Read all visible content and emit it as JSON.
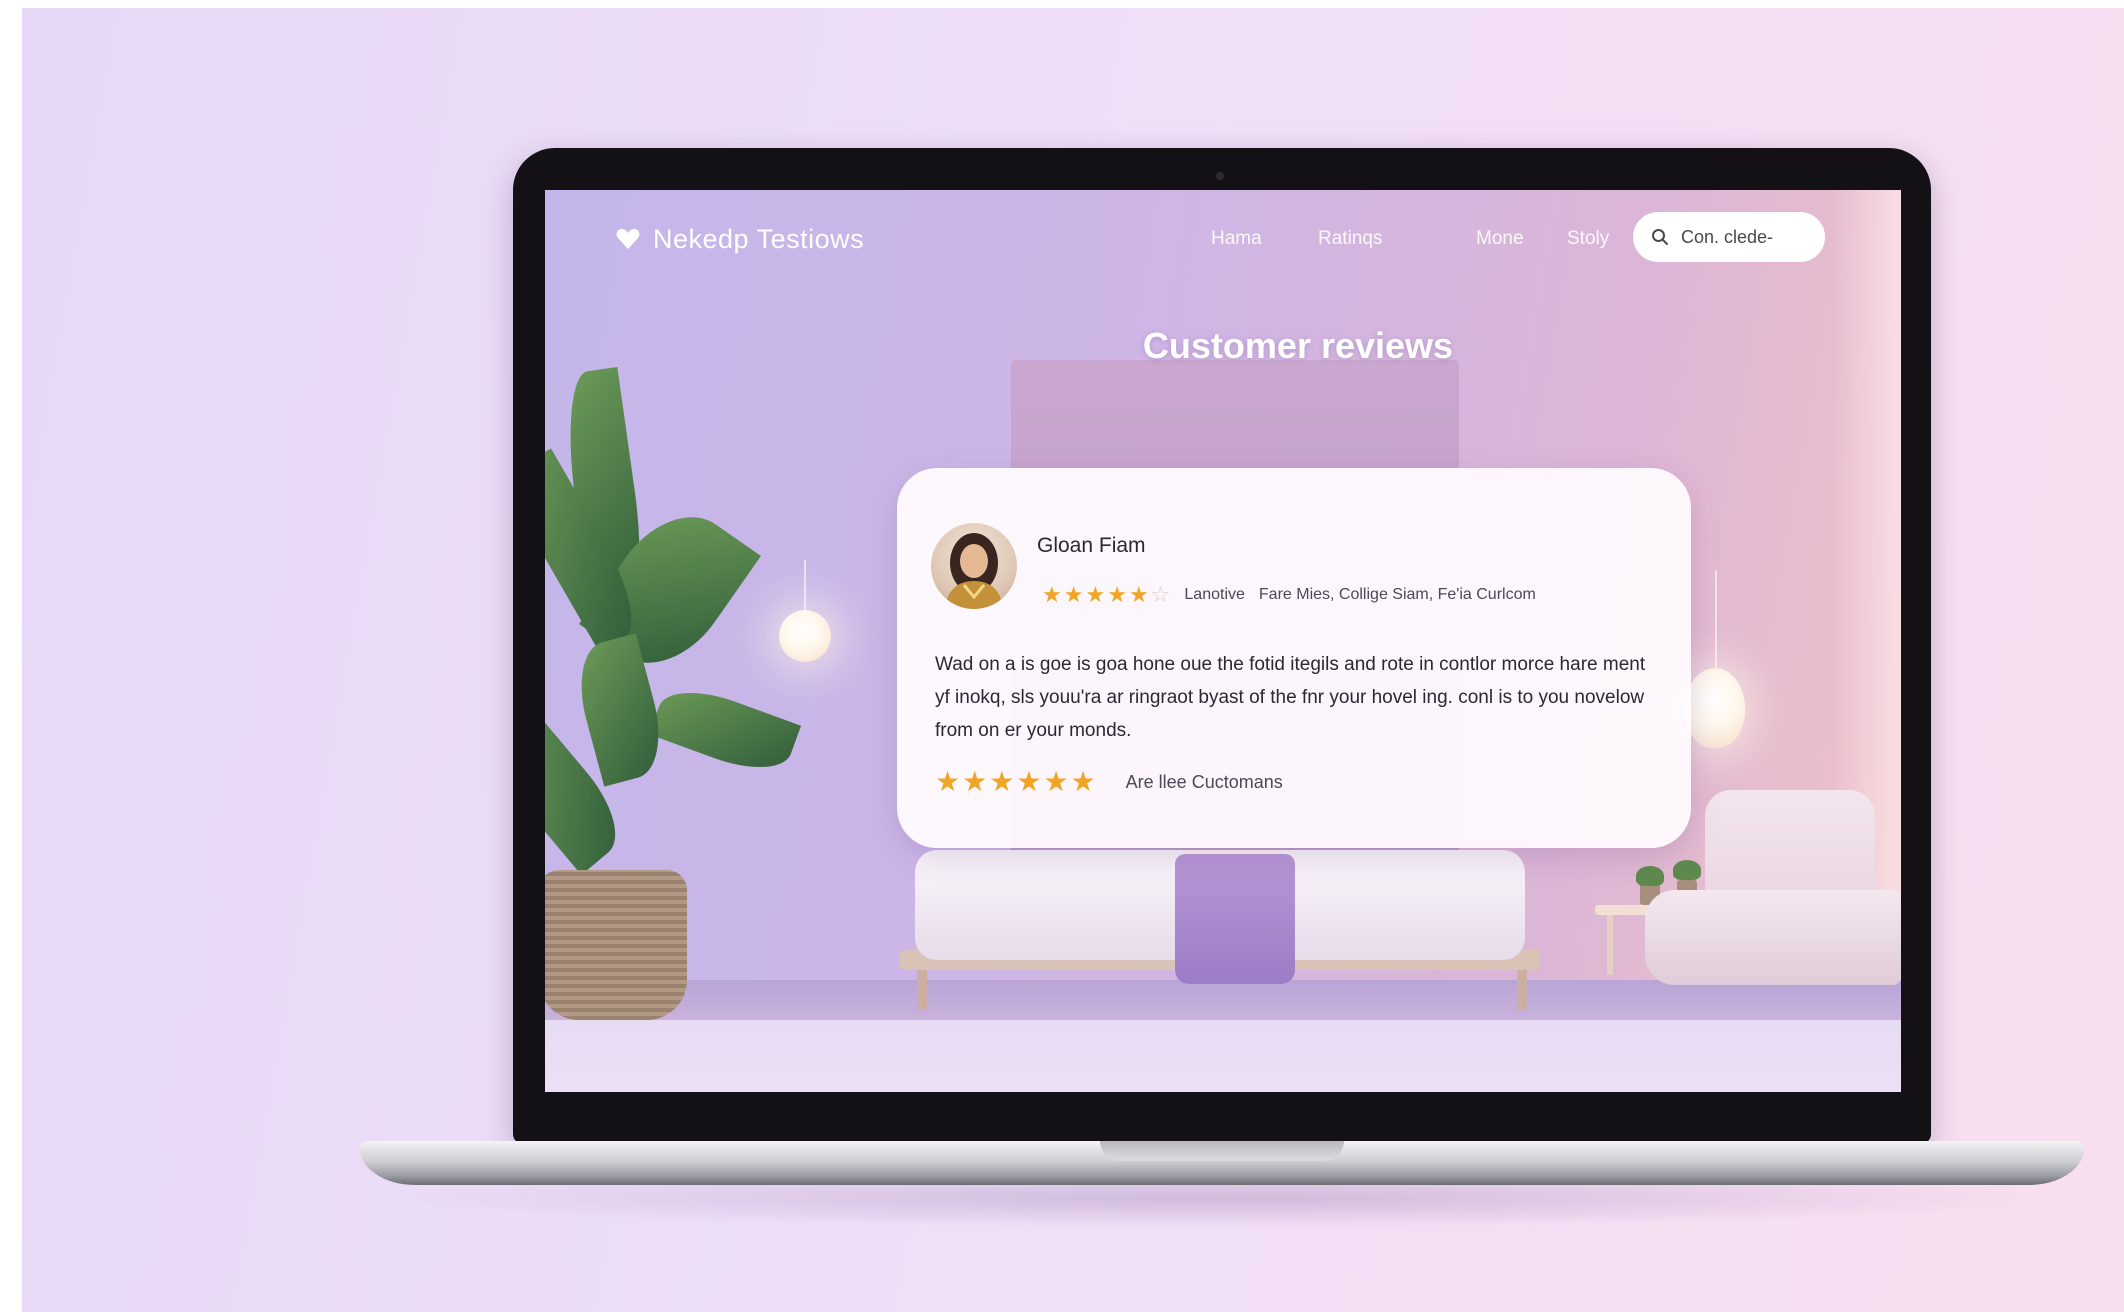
{
  "site": {
    "brand": "Nekedp Testiows",
    "nav": [
      "Hama",
      "Ratinqs",
      "Mone",
      "Stoly"
    ],
    "search_text": "Con. clede-"
  },
  "page": {
    "heading": "Customer reviews"
  },
  "review": {
    "reviewer_name": "Gloan Fiam",
    "rating_stars": 4.5,
    "rating_label": "Lanotive",
    "meta_text": "Fare Mies, Collige Siam, Fe'ia Curlcom",
    "body": "Wad on a is goe is goa hone oue the fotid itegils and rote in contlor morce hare ment yf inokq, sls youu'ra ar ringraot byast of the fnr your hovel ing. conl is to you novelow from on er your monds.",
    "footer_stars": 6,
    "footer_label": "Are llee Cuctomans"
  },
  "colors": {
    "background": "#ead9f7",
    "star": "#f0a526",
    "card": "#fffbff",
    "laptop_bezel": "#141116"
  }
}
